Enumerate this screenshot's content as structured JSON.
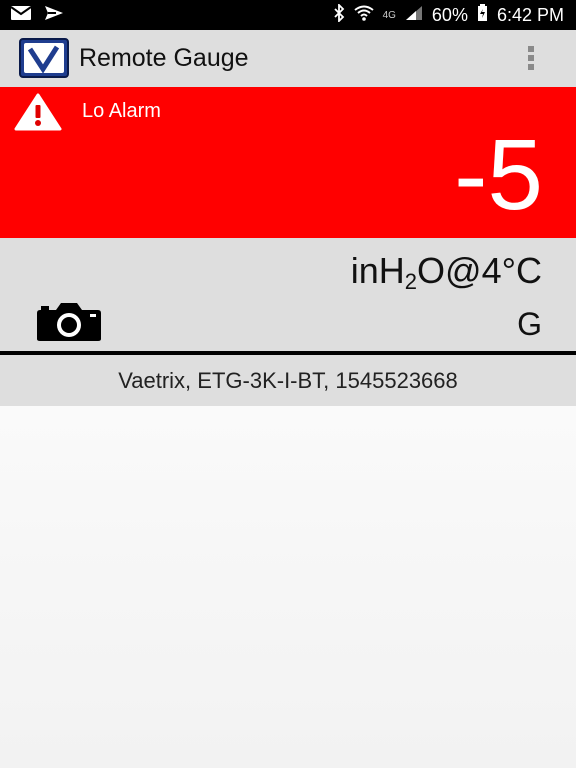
{
  "status_bar": {
    "icons": [
      "mail-icon",
      "send-icon",
      "bluetooth-icon",
      "wifi-icon",
      "signal-icon",
      "battery-icon"
    ],
    "network": "4G",
    "battery": "60%",
    "time": "6:42 PM"
  },
  "app_bar": {
    "logo": "V",
    "title": "Remote Gauge",
    "menu_icon": "overflow-menu-icon"
  },
  "alarm": {
    "icon": "warning-icon",
    "label": "Lo Alarm",
    "reading": "-5",
    "colors": {
      "background": "#ff0000",
      "text": "#ffffff"
    }
  },
  "gauge_info": {
    "units_prefix": "inH",
    "units_sub": "2",
    "units_suffix": "O@4°C",
    "camera_icon": "camera-icon",
    "type": "G"
  },
  "device": {
    "info": "Vaetrix, ETG-3K-I-BT, 1545523668"
  },
  "colors": {
    "panel": "#dedede",
    "alarm": "#ff0000",
    "logo_blue": "#1f3d8f"
  }
}
